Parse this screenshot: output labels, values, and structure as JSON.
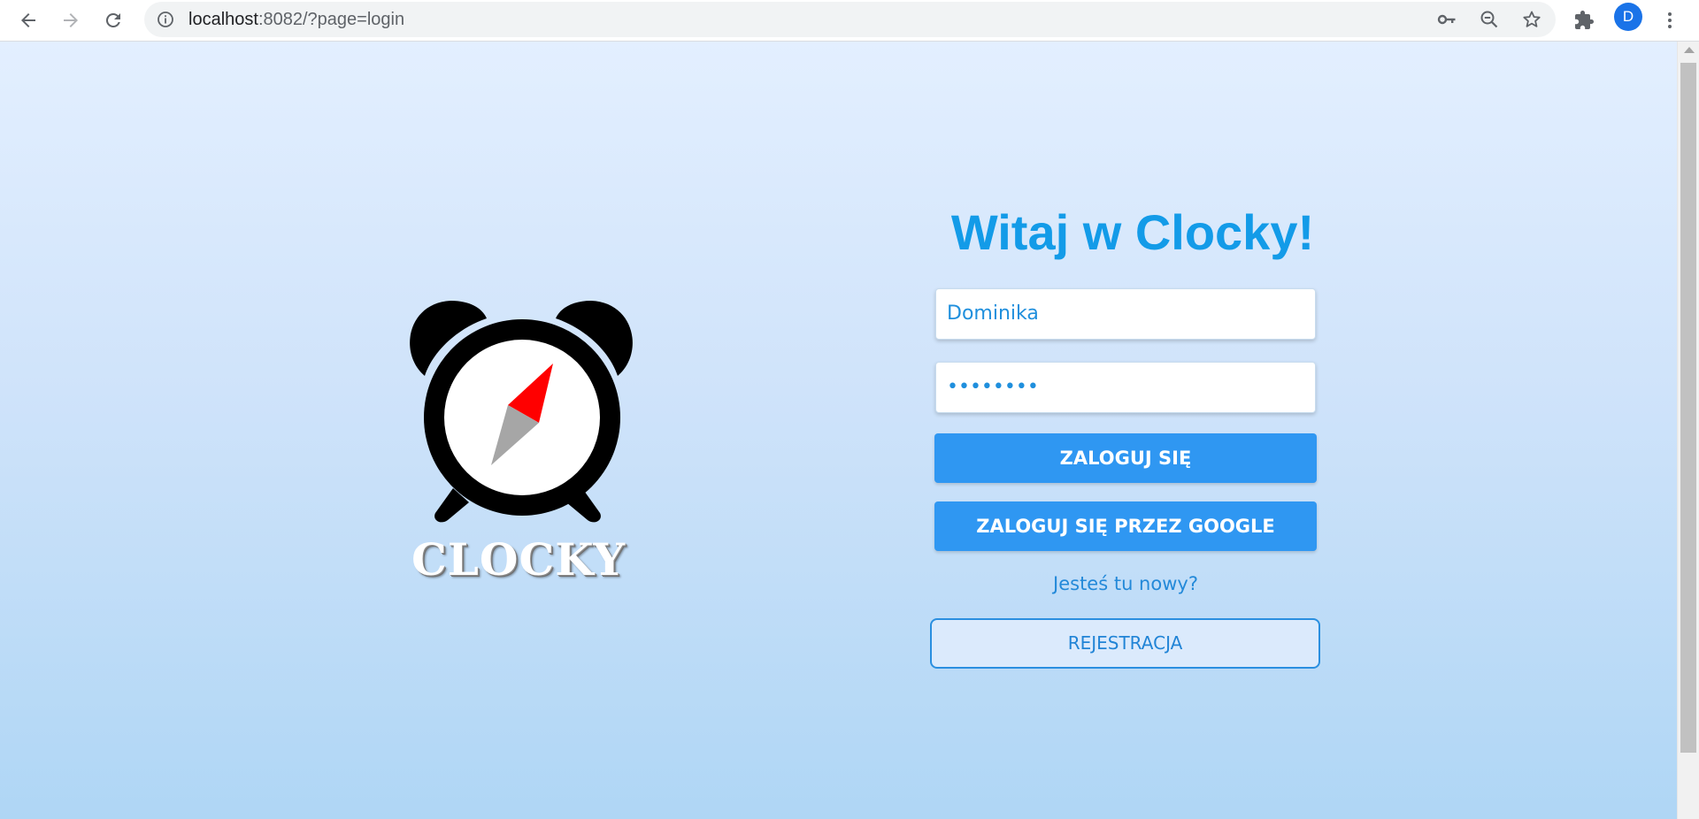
{
  "browser": {
    "url_host": "localhost",
    "url_rest": ":8082/?page=login",
    "avatar_letter": "D",
    "icons": [
      "back-arrow-icon",
      "forward-arrow-icon",
      "reload-icon",
      "info-icon",
      "key-icon",
      "zoom-out-icon",
      "star-icon",
      "extensions-icon",
      "more-vert-icon"
    ]
  },
  "logo": {
    "wordmark": "CLOCKY",
    "colors": {
      "body": "#000000",
      "face": "#ffffff",
      "needle_north": "#ff0000",
      "needle_south": "#a6a6a6"
    }
  },
  "login": {
    "title": "Witaj w Clocky!",
    "username_value": "Dominika",
    "password_value": "••••••••",
    "login_button": "ZALOGUJ SIĘ",
    "google_button": "ZALOGUJ SIĘ PRZEZ GOOGLE",
    "new_user_text": "Jesteś tu nowy?",
    "register_button": "REJESTRACJA"
  },
  "colors": {
    "accent": "#2f97f2",
    "title": "#139be8",
    "background_top": "#e3efff",
    "background_bottom": "#afd6f5"
  }
}
